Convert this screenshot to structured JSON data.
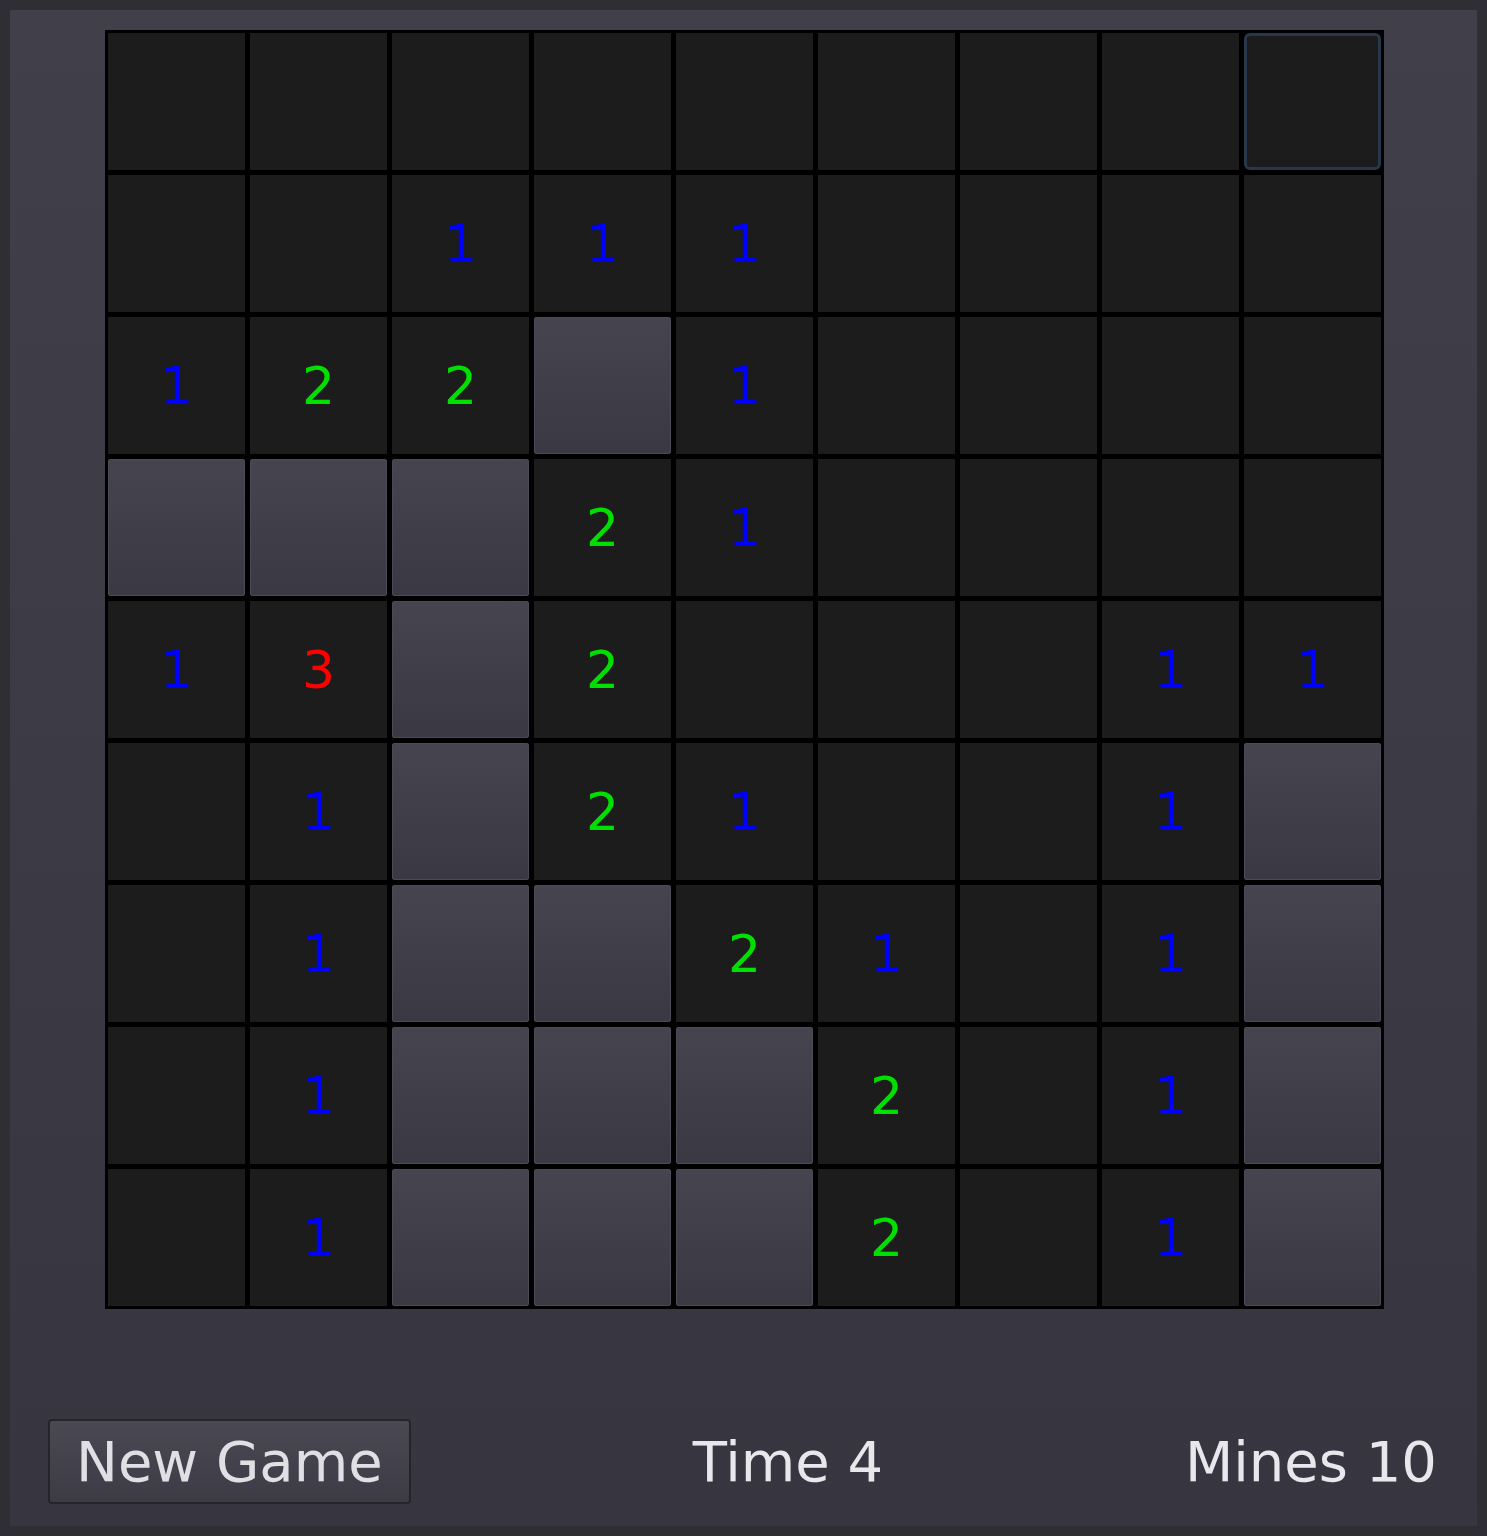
{
  "board": {
    "rows": [
      [
        {
          "kind": "revealed",
          "focused": false
        },
        {
          "kind": "revealed",
          "focused": false
        },
        {
          "kind": "revealed",
          "focused": false
        },
        {
          "kind": "revealed",
          "focused": false
        },
        {
          "kind": "revealed",
          "focused": false
        },
        {
          "kind": "revealed",
          "focused": false
        },
        {
          "kind": "revealed",
          "focused": false
        },
        {
          "kind": "revealed",
          "focused": false
        },
        {
          "kind": "revealed",
          "focused": true
        }
      ],
      [
        {
          "kind": "revealed",
          "focused": false
        },
        {
          "kind": "revealed",
          "focused": false
        },
        {
          "kind": "revealed",
          "text": "1",
          "color": "#0000ff",
          "focused": false
        },
        {
          "kind": "revealed",
          "text": "1",
          "color": "#0000ff",
          "focused": false
        },
        {
          "kind": "revealed",
          "text": "1",
          "color": "#0000ff",
          "focused": false
        },
        {
          "kind": "revealed",
          "focused": false
        },
        {
          "kind": "revealed",
          "focused": false
        },
        {
          "kind": "revealed",
          "focused": false
        },
        {
          "kind": "revealed",
          "focused": false
        }
      ],
      [
        {
          "kind": "revealed",
          "text": "1",
          "color": "#0000ff",
          "focused": false
        },
        {
          "kind": "revealed",
          "text": "2",
          "color": "#00e000",
          "focused": false
        },
        {
          "kind": "revealed",
          "text": "2",
          "color": "#00e000",
          "focused": false
        },
        {
          "kind": "hidden",
          "focused": false
        },
        {
          "kind": "revealed",
          "text": "1",
          "color": "#0000ff",
          "focused": false
        },
        {
          "kind": "revealed",
          "focused": false
        },
        {
          "kind": "revealed",
          "focused": false
        },
        {
          "kind": "revealed",
          "focused": false
        },
        {
          "kind": "revealed",
          "focused": false
        }
      ],
      [
        {
          "kind": "hidden",
          "focused": false
        },
        {
          "kind": "hidden",
          "focused": false
        },
        {
          "kind": "hidden",
          "focused": false
        },
        {
          "kind": "revealed",
          "text": "2",
          "color": "#00e000",
          "focused": false
        },
        {
          "kind": "revealed",
          "text": "1",
          "color": "#0000ff",
          "focused": false
        },
        {
          "kind": "revealed",
          "focused": false
        },
        {
          "kind": "revealed",
          "focused": false
        },
        {
          "kind": "revealed",
          "focused": false
        },
        {
          "kind": "revealed",
          "focused": false
        }
      ],
      [
        {
          "kind": "revealed",
          "text": "1",
          "color": "#0000ff",
          "focused": false
        },
        {
          "kind": "revealed",
          "text": "3",
          "color": "#ff0000",
          "focused": false
        },
        {
          "kind": "hidden",
          "focused": false
        },
        {
          "kind": "revealed",
          "text": "2",
          "color": "#00e000",
          "focused": false
        },
        {
          "kind": "revealed",
          "focused": false
        },
        {
          "kind": "revealed",
          "focused": false
        },
        {
          "kind": "revealed",
          "focused": false
        },
        {
          "kind": "revealed",
          "text": "1",
          "color": "#0000ff",
          "focused": false
        },
        {
          "kind": "revealed",
          "text": "1",
          "color": "#0000ff",
          "focused": false
        }
      ],
      [
        {
          "kind": "revealed",
          "focused": false
        },
        {
          "kind": "revealed",
          "text": "1",
          "color": "#0000ff",
          "focused": false
        },
        {
          "kind": "hidden",
          "focused": false
        },
        {
          "kind": "revealed",
          "text": "2",
          "color": "#00e000",
          "focused": false
        },
        {
          "kind": "revealed",
          "text": "1",
          "color": "#0000ff",
          "focused": false
        },
        {
          "kind": "revealed",
          "focused": false
        },
        {
          "kind": "revealed",
          "focused": false
        },
        {
          "kind": "revealed",
          "text": "1",
          "color": "#0000ff",
          "focused": false
        },
        {
          "kind": "hidden",
          "focused": false
        }
      ],
      [
        {
          "kind": "revealed",
          "focused": false
        },
        {
          "kind": "revealed",
          "text": "1",
          "color": "#0000ff",
          "focused": false
        },
        {
          "kind": "hidden",
          "focused": false
        },
        {
          "kind": "hidden",
          "focused": false
        },
        {
          "kind": "revealed",
          "text": "2",
          "color": "#00e000",
          "focused": false
        },
        {
          "kind": "revealed",
          "text": "1",
          "color": "#0000ff",
          "focused": false
        },
        {
          "kind": "revealed",
          "focused": false
        },
        {
          "kind": "revealed",
          "text": "1",
          "color": "#0000ff",
          "focused": false
        },
        {
          "kind": "hidden",
          "focused": false
        }
      ],
      [
        {
          "kind": "revealed",
          "focused": false
        },
        {
          "kind": "revealed",
          "text": "1",
          "color": "#0000ff",
          "focused": false
        },
        {
          "kind": "hidden",
          "focused": false
        },
        {
          "kind": "hidden",
          "focused": false
        },
        {
          "kind": "hidden",
          "focused": false
        },
        {
          "kind": "revealed",
          "text": "2",
          "color": "#00e000",
          "focused": false
        },
        {
          "kind": "revealed",
          "focused": false
        },
        {
          "kind": "revealed",
          "text": "1",
          "color": "#0000ff",
          "focused": false
        },
        {
          "kind": "hidden",
          "focused": false
        }
      ],
      [
        {
          "kind": "revealed",
          "focused": false
        },
        {
          "kind": "revealed",
          "text": "1",
          "color": "#0000ff",
          "focused": false
        },
        {
          "kind": "hidden",
          "focused": false
        },
        {
          "kind": "hidden",
          "focused": false
        },
        {
          "kind": "hidden",
          "focused": false
        },
        {
          "kind": "revealed",
          "text": "2",
          "color": "#00e000",
          "focused": false
        },
        {
          "kind": "revealed",
          "focused": false
        },
        {
          "kind": "revealed",
          "text": "1",
          "color": "#0000ff",
          "focused": false
        },
        {
          "kind": "hidden",
          "focused": false
        }
      ]
    ]
  },
  "footer": {
    "new_game_button": "New Game",
    "time": "Time 4",
    "mines": "Mines 10"
  }
}
